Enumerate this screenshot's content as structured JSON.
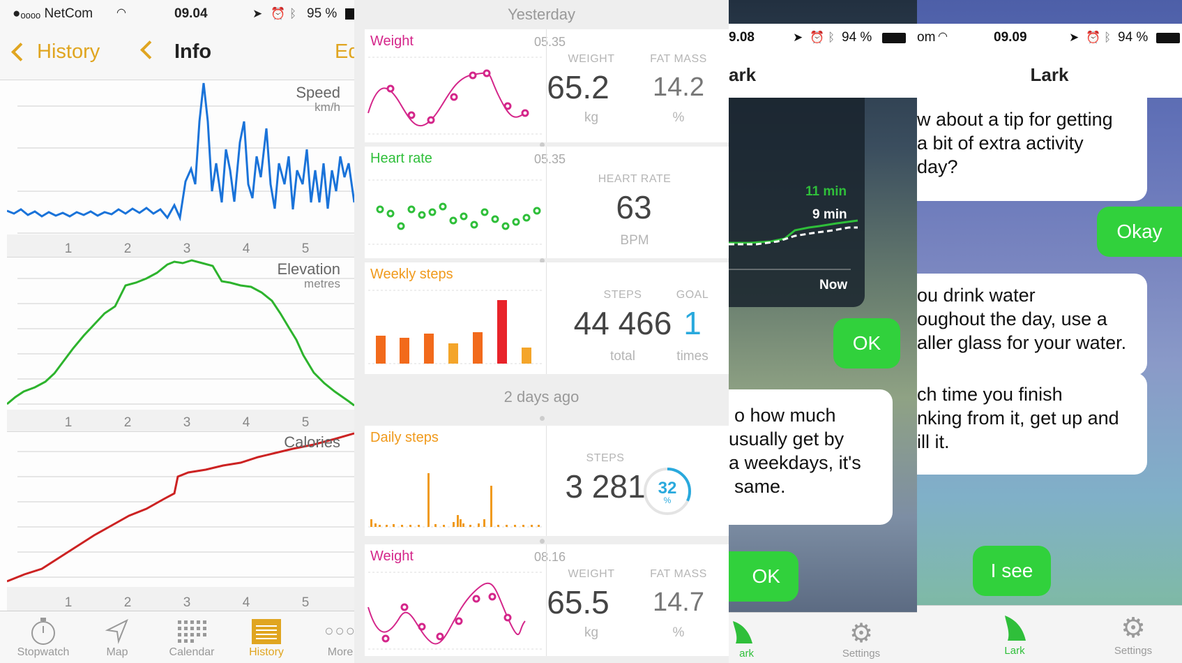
{
  "panel_a": {
    "status": {
      "carrier": "●ₒₒₒₒ NetCom",
      "time": "09.04",
      "battery": "95 %"
    },
    "nav": {
      "back_label": "History",
      "title": "Info",
      "edit_label": "Ed"
    },
    "charts": [
      {
        "title": "Speed",
        "unit": "km/h"
      },
      {
        "title": "Elevation",
        "unit": "metres"
      },
      {
        "title": "Calories",
        "unit": ""
      }
    ],
    "x_ticks": [
      "1",
      "2",
      "3",
      "4",
      "5"
    ],
    "tabs": [
      {
        "label": "Stopwatch",
        "icon": "stopwatch-icon"
      },
      {
        "label": "Map",
        "icon": "map-arrow-icon"
      },
      {
        "label": "Calendar",
        "icon": "calendar-grid-icon"
      },
      {
        "label": "History",
        "icon": "history-list-icon"
      },
      {
        "label": "More",
        "icon": "more-dots-icon"
      }
    ],
    "accent": "#e0a520",
    "series_colors": {
      "speed": "#1a73d9",
      "elevation": "#2db32d",
      "calories": "#cc2222"
    }
  },
  "panel_b": {
    "sections": {
      "yesterday": "Yesterday",
      "two_days": "2 days ago"
    },
    "cards": {
      "weight1": {
        "title": "Weight",
        "time": "05.35",
        "l1": "WEIGHT",
        "v1": "65.2",
        "u1": "kg",
        "l2": "FAT MASS",
        "v2": "14.2",
        "u2": "%"
      },
      "heart": {
        "title": "Heart rate",
        "time": "05.35",
        "l1": "HEART RATE",
        "v1": "63",
        "u1": "BPM"
      },
      "weekly": {
        "title": "Weekly steps",
        "l1": "STEPS",
        "v1": "44 466",
        "u1": "total",
        "l2": "GOAL",
        "v2": "1",
        "u2": "times"
      },
      "daily": {
        "title": "Daily steps",
        "l1": "STEPS",
        "v1": "3 281",
        "ring_value": "32",
        "ring_unit": "%",
        "ring_fraction": 0.32
      },
      "weight2": {
        "title": "Weight",
        "time": "08.16",
        "l1": "WEIGHT",
        "v1": "65.5",
        "u1": "kg",
        "l2": "FAT MASS",
        "v2": "14.7",
        "u2": "%"
      }
    },
    "colors": {
      "weight": "#d4268a",
      "heart": "#2fbf3a",
      "steps": "#f09a1c",
      "ring": "#29a9dd",
      "goal": "#29a9dd"
    }
  },
  "panel_c": {
    "status": {
      "time": "9.08",
      "battery": "94 %"
    },
    "title": "ark",
    "graph": {
      "label_a": "11 min",
      "label_b": "9 min",
      "now": "Now"
    },
    "bubbles": {
      "ok": "OK",
      "msg": [
        "o how much",
        "usually get by",
        "a weekdays, it's",
        "same."
      ],
      "ok2": "OK"
    },
    "tabs": [
      {
        "label": "ark",
        "icon": "lark-bird-icon"
      },
      {
        "label": "Settings",
        "icon": "gear-icon"
      }
    ]
  },
  "panel_d": {
    "status": {
      "carrier": "om",
      "time": "09.09",
      "battery": "94 %"
    },
    "title": "Lark",
    "bubbles": {
      "tip": [
        "w about a tip for getting",
        "a bit of extra activity",
        "day?"
      ],
      "okay": "Okay",
      "water": [
        "ou drink water",
        "oughout the day, use a",
        "aller glass for your water."
      ],
      "finish": [
        "ch time you finish",
        "nking from it, get up and",
        "ill it."
      ],
      "isee": "I see"
    },
    "tabs": [
      {
        "label": "Lark",
        "icon": "lark-bird-icon"
      },
      {
        "label": "Settings",
        "icon": "gear-icon"
      }
    ]
  }
}
